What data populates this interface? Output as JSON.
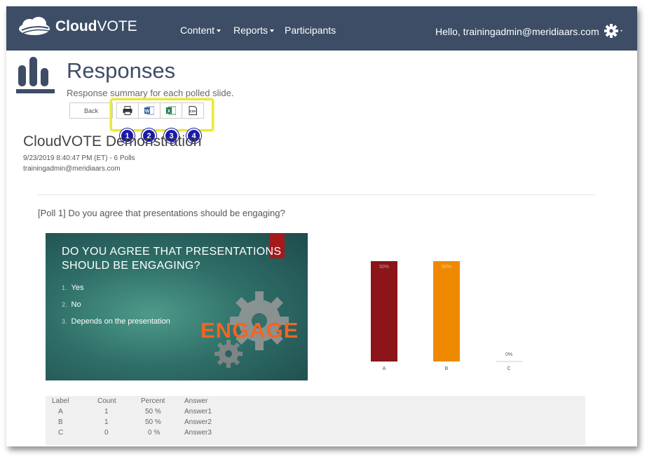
{
  "nav": {
    "brand_bold": "Cloud",
    "brand_light": "VOTE",
    "items": [
      {
        "label": "Content",
        "dropdown": true
      },
      {
        "label": "Reports",
        "dropdown": true
      },
      {
        "label": "Participants",
        "dropdown": false
      }
    ],
    "greeting": "Hello, trainingadmin@meridiaars.com"
  },
  "page": {
    "title": "Responses",
    "subtitle": "Response summary for each polled slide."
  },
  "toolbar": {
    "back_label": "Back",
    "export_buttons": [
      {
        "icon": "print-icon",
        "badge": "1"
      },
      {
        "icon": "word-icon",
        "badge": "2"
      },
      {
        "icon": "excel-icon",
        "badge": "3"
      },
      {
        "icon": "csv-icon",
        "badge": "4",
        "text": "CSV"
      }
    ]
  },
  "session": {
    "title": "CloudVOTE Demonstration",
    "meta": "9/23/2019 8:40:47 PM (ET) - 6 Polls",
    "user": "trainingadmin@meridiaars.com"
  },
  "poll": {
    "question": "[Poll 1] Do you agree that presentations should be engaging?",
    "slide": {
      "title_line1": "DO YOU AGREE THAT PRESENTATIONS",
      "title_line2": "SHOULD BE ENGAGING?",
      "items": [
        {
          "num": "1.",
          "text": "Yes"
        },
        {
          "num": "2.",
          "text": "No"
        },
        {
          "num": "3.",
          "text": "Depends on the presentation"
        }
      ],
      "graphic_word": "ENGAGE"
    },
    "table": {
      "headers": [
        "Label",
        "Count",
        "Percent",
        "Answer"
      ],
      "rows": [
        [
          "A",
          "1",
          "50 %",
          "Answer1"
        ],
        [
          "B",
          "1",
          "50 %",
          "Answer2"
        ],
        [
          "C",
          "0",
          "0 %",
          "Answer3"
        ]
      ]
    }
  },
  "chart_data": {
    "type": "bar",
    "categories": [
      "A",
      "B",
      "C"
    ],
    "values": [
      50,
      50,
      0
    ],
    "value_labels": [
      "50%",
      "50%",
      "0%"
    ],
    "colors": [
      "#8b1518",
      "#ef8a00",
      "#cccccc"
    ],
    "ylim": [
      0,
      50
    ]
  },
  "colors": {
    "navbar": "#3d4d66",
    "highlight": "#e8e83a",
    "badge": "#1a1aa8"
  }
}
